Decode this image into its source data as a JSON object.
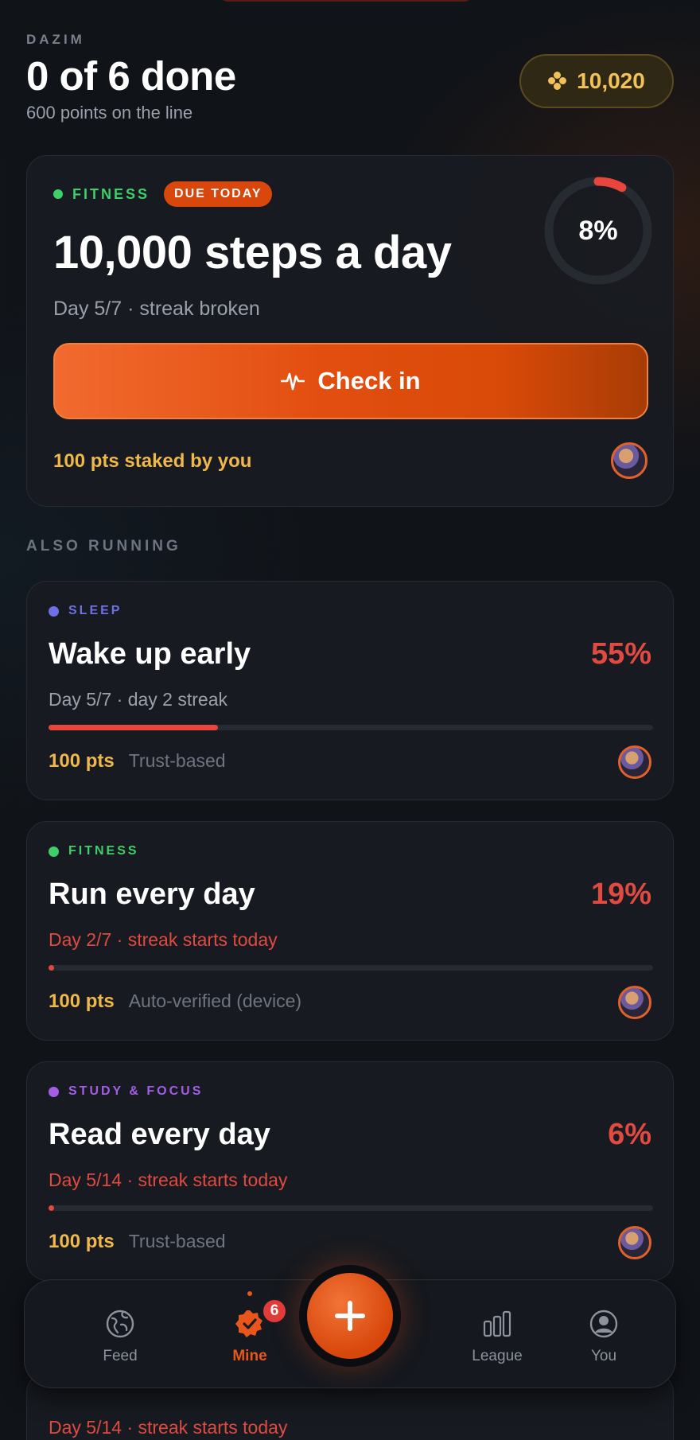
{
  "header": {
    "brand": "DAZIM",
    "title": "0 of 6 done",
    "subtitle": "600 points on the line",
    "points_balance": "10,020"
  },
  "featured": {
    "category": "FITNESS",
    "category_color": "#3fcf6a",
    "due_badge": "DUE TODAY",
    "title": "10,000 steps a day",
    "meta": "Day 5/7 · streak broken",
    "progress_percent": "8%",
    "progress_fraction": 0.08,
    "checkin_label": "Check in",
    "staked_text": "100 pts staked by you"
  },
  "section_label": "ALSO RUNNING",
  "habits": [
    {
      "category": "SLEEP",
      "category_color": "#6f6fe6",
      "title": "Wake up early",
      "percent": "55%",
      "progress_fraction": 0.28,
      "meta": "Day 5/7 · day 2 streak",
      "meta_alert": false,
      "points": "100 pts",
      "verification": "Trust-based"
    },
    {
      "category": "FITNESS",
      "category_color": "#3fcf6a",
      "title": "Run every day",
      "percent": "19%",
      "progress_fraction": 0.0,
      "meta": "Day 2/7 · streak starts today",
      "meta_alert": true,
      "points": "100 pts",
      "verification": "Auto-verified (device)"
    },
    {
      "category": "STUDY & FOCUS",
      "category_color": "#a45ee6",
      "title": "Read every day",
      "percent": "6%",
      "progress_fraction": 0.0,
      "meta": "Day 5/14 · streak starts today",
      "meta_alert": true,
      "points": "100 pts",
      "verification": "Trust-based"
    },
    {
      "meta": "Day 5/14 · streak starts today"
    }
  ],
  "nav": {
    "feed": "Feed",
    "mine": "Mine",
    "mine_badge": "6",
    "league": "League",
    "you": "You",
    "fab_icon": "plus-icon"
  }
}
